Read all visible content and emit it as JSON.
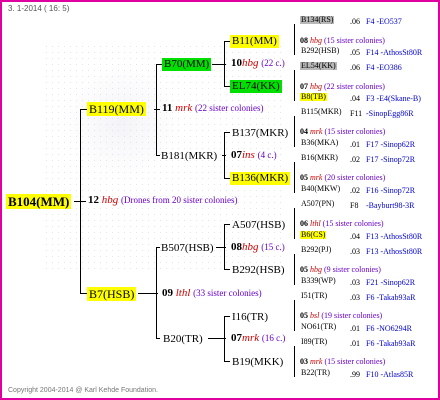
{
  "date": "3. 1-2014 ( 16: 5)",
  "copyright": "Copyright 2004-2014 @ Karl Kehde Foundation.",
  "root": {
    "label": "B104(MM)",
    "num": "12",
    "drone": "hbg",
    "info": "(Drones from 20 sister colonies)"
  },
  "gen1": {
    "top": {
      "label": "B119(MM)",
      "num": "11",
      "drone": "mrk",
      "info": "(22 sister colonies)"
    },
    "bottom": {
      "label": "B7(HSB)",
      "num": "09",
      "drone": "lthl",
      "info": "(33 sister colonies)"
    }
  },
  "gen2": {
    "a": {
      "label": "B70(MM)",
      "num": "10",
      "drone": "hbg",
      "info": "(22 c.)"
    },
    "b": {
      "label": "B181(MKR)",
      "num": "07",
      "drone": "ins",
      "info": "(4 c.)"
    },
    "c": {
      "label": "B507(HSB)",
      "num": "08",
      "drone": "hbg",
      "info": "(15 c.)"
    },
    "d": {
      "label": "B20(TR)",
      "num": "07",
      "drone": "mrk",
      "info": "(16 c.)"
    }
  },
  "gen3": [
    {
      "label": "B11(MM)",
      "num": "08",
      "drone": "hbg",
      "info": "(15 sister colonies)"
    },
    {
      "label": "EL74(KK)",
      "num": "07",
      "drone": "hbg",
      "info": "(22 sister colonies)"
    },
    {
      "label": "B137(MKR)",
      "num": "04",
      "drone": "mrk",
      "info": "(15 sister colonies)"
    },
    {
      "label": "B136(MKR)",
      "num": "05",
      "drone": "mrk",
      "info": "(20 sister colonies)"
    },
    {
      "label": "A507(HSB)",
      "num": "06",
      "drone": "lthl",
      "info": "(15 sister colonies)"
    },
    {
      "label": "B292(HSB)",
      "num": "05",
      "drone": "hbg",
      "info": "(9 sister colonies)"
    },
    {
      "label": "I16(TR)",
      "num": "05",
      "drone": "bsl",
      "info": "(19 sister colonies)"
    },
    {
      "label": "B19(MKK)",
      "num": "03",
      "drone": "mrk",
      "info": "(15 sister colonies)"
    }
  ],
  "gen4": [
    {
      "label": "B134(RS)",
      "pnum": ".06",
      "ref": "F4 -EO537"
    },
    {
      "label": "B292(HSB)",
      "pnum": ".05",
      "ref": "F14 -AthosSt80R"
    },
    {
      "label": "EL54(KK)",
      "pnum": ".06",
      "ref": "F4 -EO386"
    },
    {
      "label": "B8(TB)",
      "pnum": ".04",
      "ref": "F3 -E4(Skane-B)"
    },
    {
      "label": "B115(MKR)",
      "pnum": "F11",
      "ref": "-SinopEgg86R"
    },
    {
      "label": "B36(MKA)",
      "pnum": ".01",
      "ref": "F17 -Sinop62R"
    },
    {
      "label": "B16(MKR)",
      "pnum": ".02",
      "ref": "F17 -Sinop72R"
    },
    {
      "label": "B40(MKW)",
      "pnum": ".02",
      "ref": "F16 -Sinop72R"
    },
    {
      "label": "A507(PN)",
      "pnum": "F8",
      "ref": "-Bayburt98-3R"
    },
    {
      "label": "B6(CS)",
      "pnum": ".04",
      "ref": "F13 -AthosSt80R"
    },
    {
      "label": "B292(PJ)",
      "pnum": ".03",
      "ref": "F13 -AthosSt80R"
    },
    {
      "label": "B339(WP)",
      "pnum": ".03",
      "ref": "F21 -Sinop62R"
    },
    {
      "label": "I51(TR)",
      "pnum": ".03",
      "ref": "F6 -Takab93aR"
    },
    {
      "label": "NO61(TR)",
      "pnum": ".01",
      "ref": "F6 -NO6294R"
    },
    {
      "label": "I89(TR)",
      "pnum": ".01",
      "ref": "F6 -Takab93aR"
    },
    {
      "label": "B22(TR)",
      "pnum": ".99",
      "ref": "F10 -Atlas85R"
    }
  ]
}
